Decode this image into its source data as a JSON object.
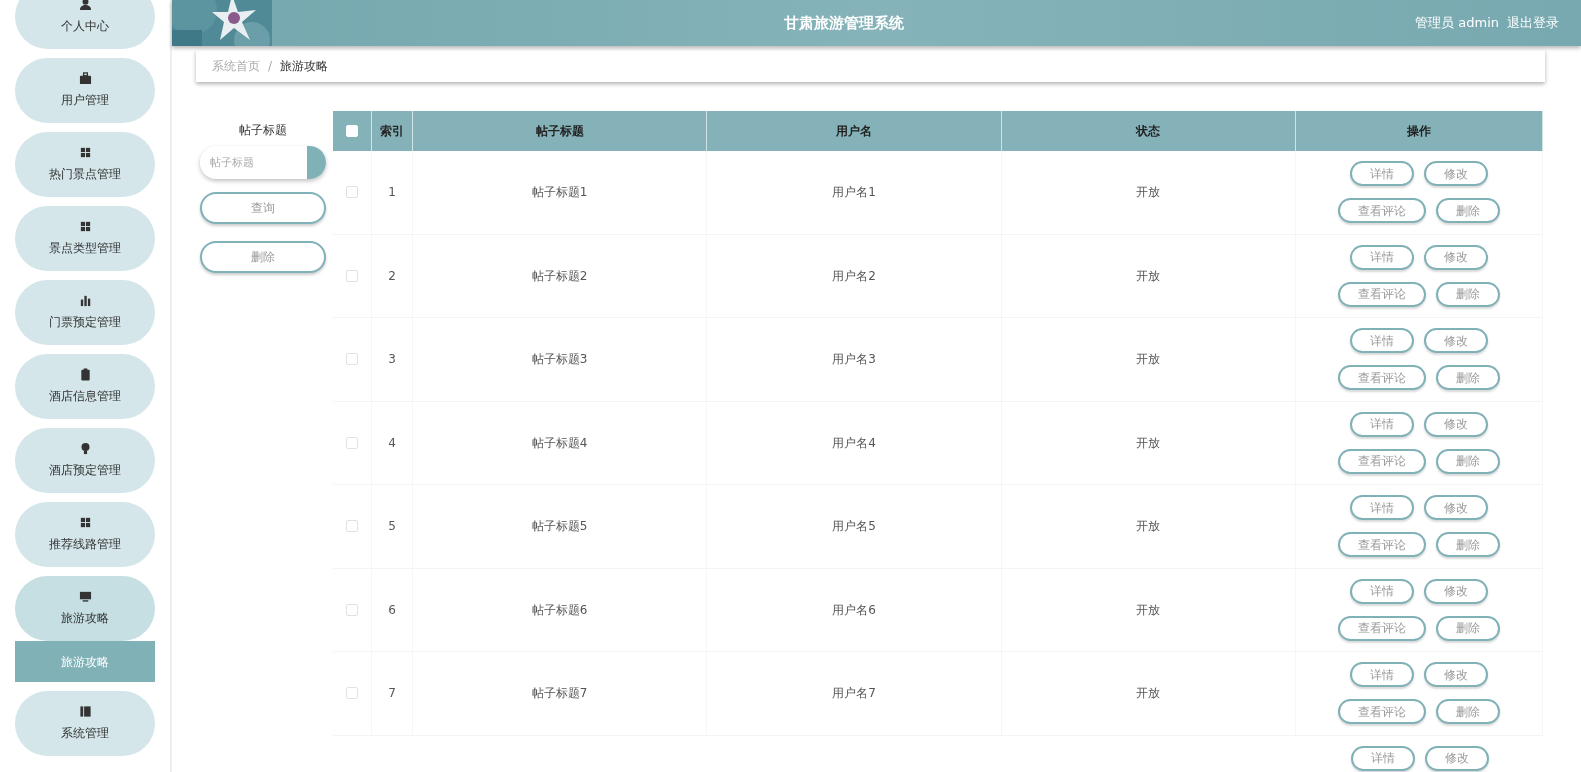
{
  "header": {
    "title": "甘肃旅游管理系统",
    "user": "管理员 admin",
    "logout": "退出登录"
  },
  "sidebar": {
    "items": [
      {
        "label": "个人中心",
        "expanded": false
      },
      {
        "label": "用户管理",
        "expanded": false
      },
      {
        "label": "热门景点管理",
        "expanded": false
      },
      {
        "label": "景点类型管理",
        "expanded": false
      },
      {
        "label": "门票预定管理",
        "expanded": false
      },
      {
        "label": "酒店信息管理",
        "expanded": false
      },
      {
        "label": "酒店预定管理",
        "expanded": false
      },
      {
        "label": "推荐线路管理",
        "expanded": false
      },
      {
        "label": "旅游攻略",
        "expanded": true,
        "children": [
          {
            "label": "旅游攻略",
            "selected": true
          }
        ]
      },
      {
        "label": "系统管理",
        "expanded": false
      }
    ]
  },
  "breadcrumb_separator": "/",
  "breadcrumb": [
    {
      "label": "系统首页",
      "selected": false
    },
    {
      "label": "旅游攻略",
      "selected": true
    }
  ],
  "filter": {
    "label": "帖子标题",
    "placeholder": "帖子标题",
    "buttons": [
      "查询",
      "删除"
    ]
  },
  "table": {
    "header_checked": false,
    "columns": [
      "索引",
      "帖子标题",
      "用户名",
      "状态",
      "操作"
    ],
    "rows": [
      {
        "checked": false,
        "cells": [
          "1",
          "帖子标题1",
          "用户名1",
          "开放"
        ],
        "actions": [
          "详情",
          "修改",
          "查看评论",
          "删除"
        ]
      },
      {
        "checked": false,
        "cells": [
          "2",
          "帖子标题2",
          "用户名2",
          "开放"
        ],
        "actions": [
          "详情",
          "修改",
          "查看评论",
          "删除"
        ]
      },
      {
        "checked": false,
        "cells": [
          "3",
          "帖子标题3",
          "用户名3",
          "开放"
        ],
        "actions": [
          "详情",
          "修改",
          "查看评论",
          "删除"
        ]
      },
      {
        "checked": false,
        "cells": [
          "4",
          "帖子标题4",
          "用户名4",
          "开放"
        ],
        "actions": [
          "详情",
          "修改",
          "查看评论",
          "删除"
        ]
      },
      {
        "checked": false,
        "cells": [
          "5",
          "帖子标题5",
          "用户名5",
          "开放"
        ],
        "actions": [
          "详情",
          "修改",
          "查看评论",
          "删除"
        ]
      },
      {
        "checked": false,
        "cells": [
          "6",
          "帖子标题6",
          "用户名6",
          "开放"
        ],
        "actions": [
          "详情",
          "修改",
          "查看评论",
          "删除"
        ]
      },
      {
        "checked": false,
        "cells": [
          "7",
          "帖子标题7",
          "用户名7",
          "开放"
        ],
        "actions": [
          "详情",
          "修改",
          "查看评论",
          "删除"
        ]
      },
      {
        "actions": [
          "详情",
          "修改"
        ]
      }
    ]
  }
}
